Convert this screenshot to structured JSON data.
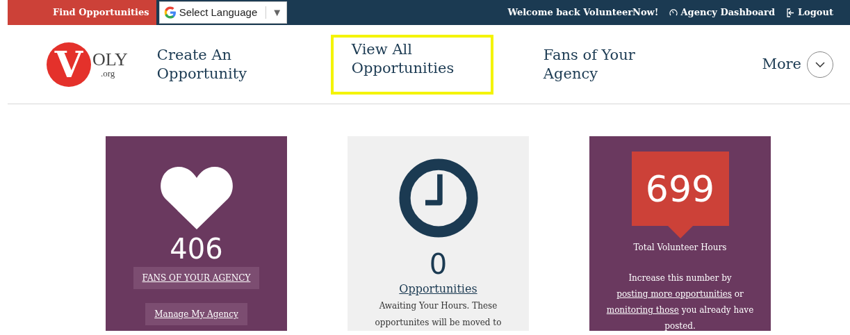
{
  "top_bar": {
    "find_button": "Find Opportunities",
    "language_select": {
      "value": "Select Language",
      "caret": "▼"
    },
    "welcome": "Welcome back VolunteerNow!",
    "links": [
      {
        "label": "Agency Dashboard"
      },
      {
        "label": "Logout"
      }
    ]
  },
  "logo": {
    "letter": "V",
    "text": "OLY",
    "suffix": ".org"
  },
  "nav": [
    {
      "label": "Create An Opportunity",
      "highlighted": false
    },
    {
      "label": "View All Opportunities",
      "highlighted": true
    },
    {
      "label": "Fans of Your Agency",
      "highlighted": false
    }
  ],
  "more": {
    "label": "More",
    "expanded": false
  },
  "cards": [
    {
      "kind": "fans",
      "value": "406",
      "buttons": [
        "FANS OF YOUR AGENCY",
        "Manage My Agency"
      ]
    },
    {
      "kind": "awaiting",
      "value": "0",
      "link": "Opportunities",
      "text": "Awaiting Your Hours. These opportunites will be moved to"
    },
    {
      "kind": "hours",
      "value": "699",
      "caption": "Total Volunteer Hours",
      "paragraph": [
        {
          "text": "Increase this number by",
          "link": false
        },
        {
          "text": "posting more opportunities",
          "link": true
        },
        {
          "text": "or",
          "link": false
        },
        {
          "text": "monitoring those",
          "link": true
        },
        {
          "text": "you already have posted.",
          "link": false
        }
      ]
    }
  ]
}
